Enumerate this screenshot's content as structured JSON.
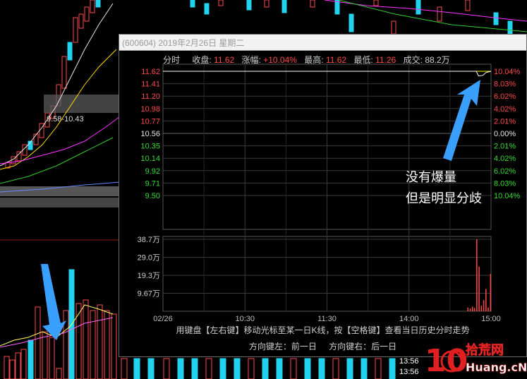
{
  "window": {
    "title": "(600604) 2019年2月26日 星期二"
  },
  "info_bar": {
    "mode_label": "分时",
    "close_label": "收盘:",
    "close_value": "11.62",
    "change_label": "涨幅:",
    "change_value": "+10.04%",
    "high_label": "最高:",
    "high_value": "11.62",
    "low_label": "最低:",
    "low_value": "11.26",
    "volume_label": "成交:",
    "volume_value": "88.2万"
  },
  "background": {
    "price_range_label": "9.58-10.43",
    "time_rows": [
      "13:56",
      "13:56"
    ]
  },
  "chart_data": {
    "type": "line",
    "price_axis_left": [
      "11.62",
      "11.41",
      "11.20",
      "10.98",
      "10.77",
      "10.56",
      "10.35",
      "10.14",
      "9.92",
      "9.71",
      "9.50"
    ],
    "price_axis_right": [
      "10.04%",
      "8.03%",
      "6.02%",
      "4.02%",
      "2.01%",
      "0.00%",
      "2.01%",
      "4.02%",
      "6.02%",
      "8.03%",
      "10.04%"
    ],
    "price_axis_colors": [
      "#ff4a4a",
      "#ff4a4a",
      "#ff4a4a",
      "#ff4a4a",
      "#ff4a4a",
      "#e8e8e8",
      "#33dd33",
      "#33dd33",
      "#33dd33",
      "#33dd33",
      "#33dd33"
    ],
    "volume_axis": [
      "38.7万",
      "29.0万",
      "19.3万",
      "9.67万"
    ],
    "volume_axis_values": [
      38.7,
      29.0,
      19.3,
      9.67
    ],
    "time_axis": [
      "02/26",
      "10:30",
      "11:30",
      "14:00",
      "15:00"
    ],
    "prev_close": 10.56,
    "price_range": [
      9.5,
      11.62
    ],
    "price_line": [
      {
        "t": 0.0,
        "p": 11.62
      },
      {
        "t": 0.955,
        "p": 11.62
      },
      {
        "t": 0.962,
        "p": 11.54
      },
      {
        "t": 0.975,
        "p": 11.55
      },
      {
        "t": 0.985,
        "p": 11.6
      },
      {
        "t": 1.0,
        "p": 11.62
      }
    ],
    "avg_line": [
      {
        "t": 0.0,
        "p": 11.62
      },
      {
        "t": 1.0,
        "p": 11.62
      }
    ],
    "volume_bars": [
      {
        "t": 0.928,
        "v": 2.0
      },
      {
        "t": 0.935,
        "v": 1.5
      },
      {
        "t": 0.942,
        "v": 2.5
      },
      {
        "t": 0.948,
        "v": 1.8
      },
      {
        "t": 0.955,
        "v": 38.7
      },
      {
        "t": 0.962,
        "v": 24.0
      },
      {
        "t": 0.969,
        "v": 3.0
      },
      {
        "t": 0.976,
        "v": 6.0
      },
      {
        "t": 0.983,
        "v": 12.0
      },
      {
        "t": 0.99,
        "v": 2.0
      },
      {
        "t": 0.997,
        "v": 20.0
      }
    ],
    "colors": {
      "price": "#ffffff",
      "avg": "#ffff00",
      "volume": "#ff4a4a",
      "grid": "#3a3a3a",
      "axis": "#555555"
    }
  },
  "hints": {
    "line1": "用键盘【左右键】移动光标至某一日K线，按【空格键】查看当日历史分时走势",
    "prev_day": "方向键左：前一日",
    "next_day": "方向键右：后一日"
  },
  "annotation": {
    "line1": "没有爆量",
    "line2": "但是明显分歧"
  },
  "logo": {
    "number": "10",
    "text": "拾荒网",
    "url_text": "Huang.cN"
  }
}
